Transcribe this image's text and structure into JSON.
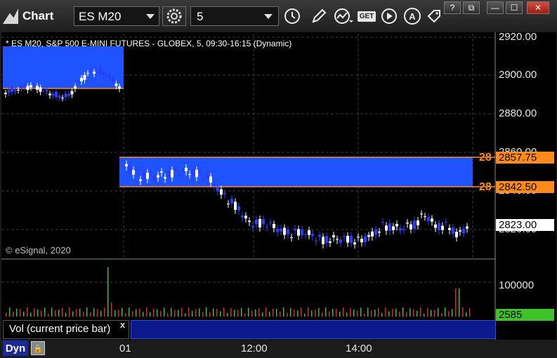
{
  "toolbar": {
    "app_title": "Chart",
    "symbol": "ES M20",
    "interval": "5",
    "icons": [
      "gear-icon",
      "clock-icon",
      "pencil-icon",
      "line-study-icon",
      "get-icon",
      "play-icon",
      "auto-icon",
      "tag-icon"
    ],
    "get_label": "GET",
    "auto_label": "A"
  },
  "window_controls": {
    "help": "?",
    "restore": "⧉",
    "minimize": "—",
    "maximize": "☐",
    "close": "✕"
  },
  "chart": {
    "title": "* ES M20, S&P 500 E-MINI FUTURES - GLOBEX, 5, 09:30-16:15 (Dynamic)",
    "copyright": "© eSignal, 2020",
    "price_axis": [
      "2920.00",
      "2900.00",
      "2880.00",
      "2860.00",
      "2840.00",
      "2820.00"
    ],
    "tags": {
      "upper": "2857.75",
      "lower": "2842.50",
      "last": "2823.00"
    },
    "level_labels": {
      "upper": "28",
      "lower": "28"
    },
    "time_axis": [
      "01",
      "12:00",
      "14:00"
    ],
    "colors": {
      "zone": "#1f53ff",
      "level": "#ff8a1c",
      "up": "#ffffff",
      "down": "#2b3cff"
    }
  },
  "volume": {
    "label": "Vol (current price bar)",
    "axis": "100000",
    "last": "2585",
    "close_label": "x"
  },
  "footer": {
    "dyn": "Dyn"
  }
}
